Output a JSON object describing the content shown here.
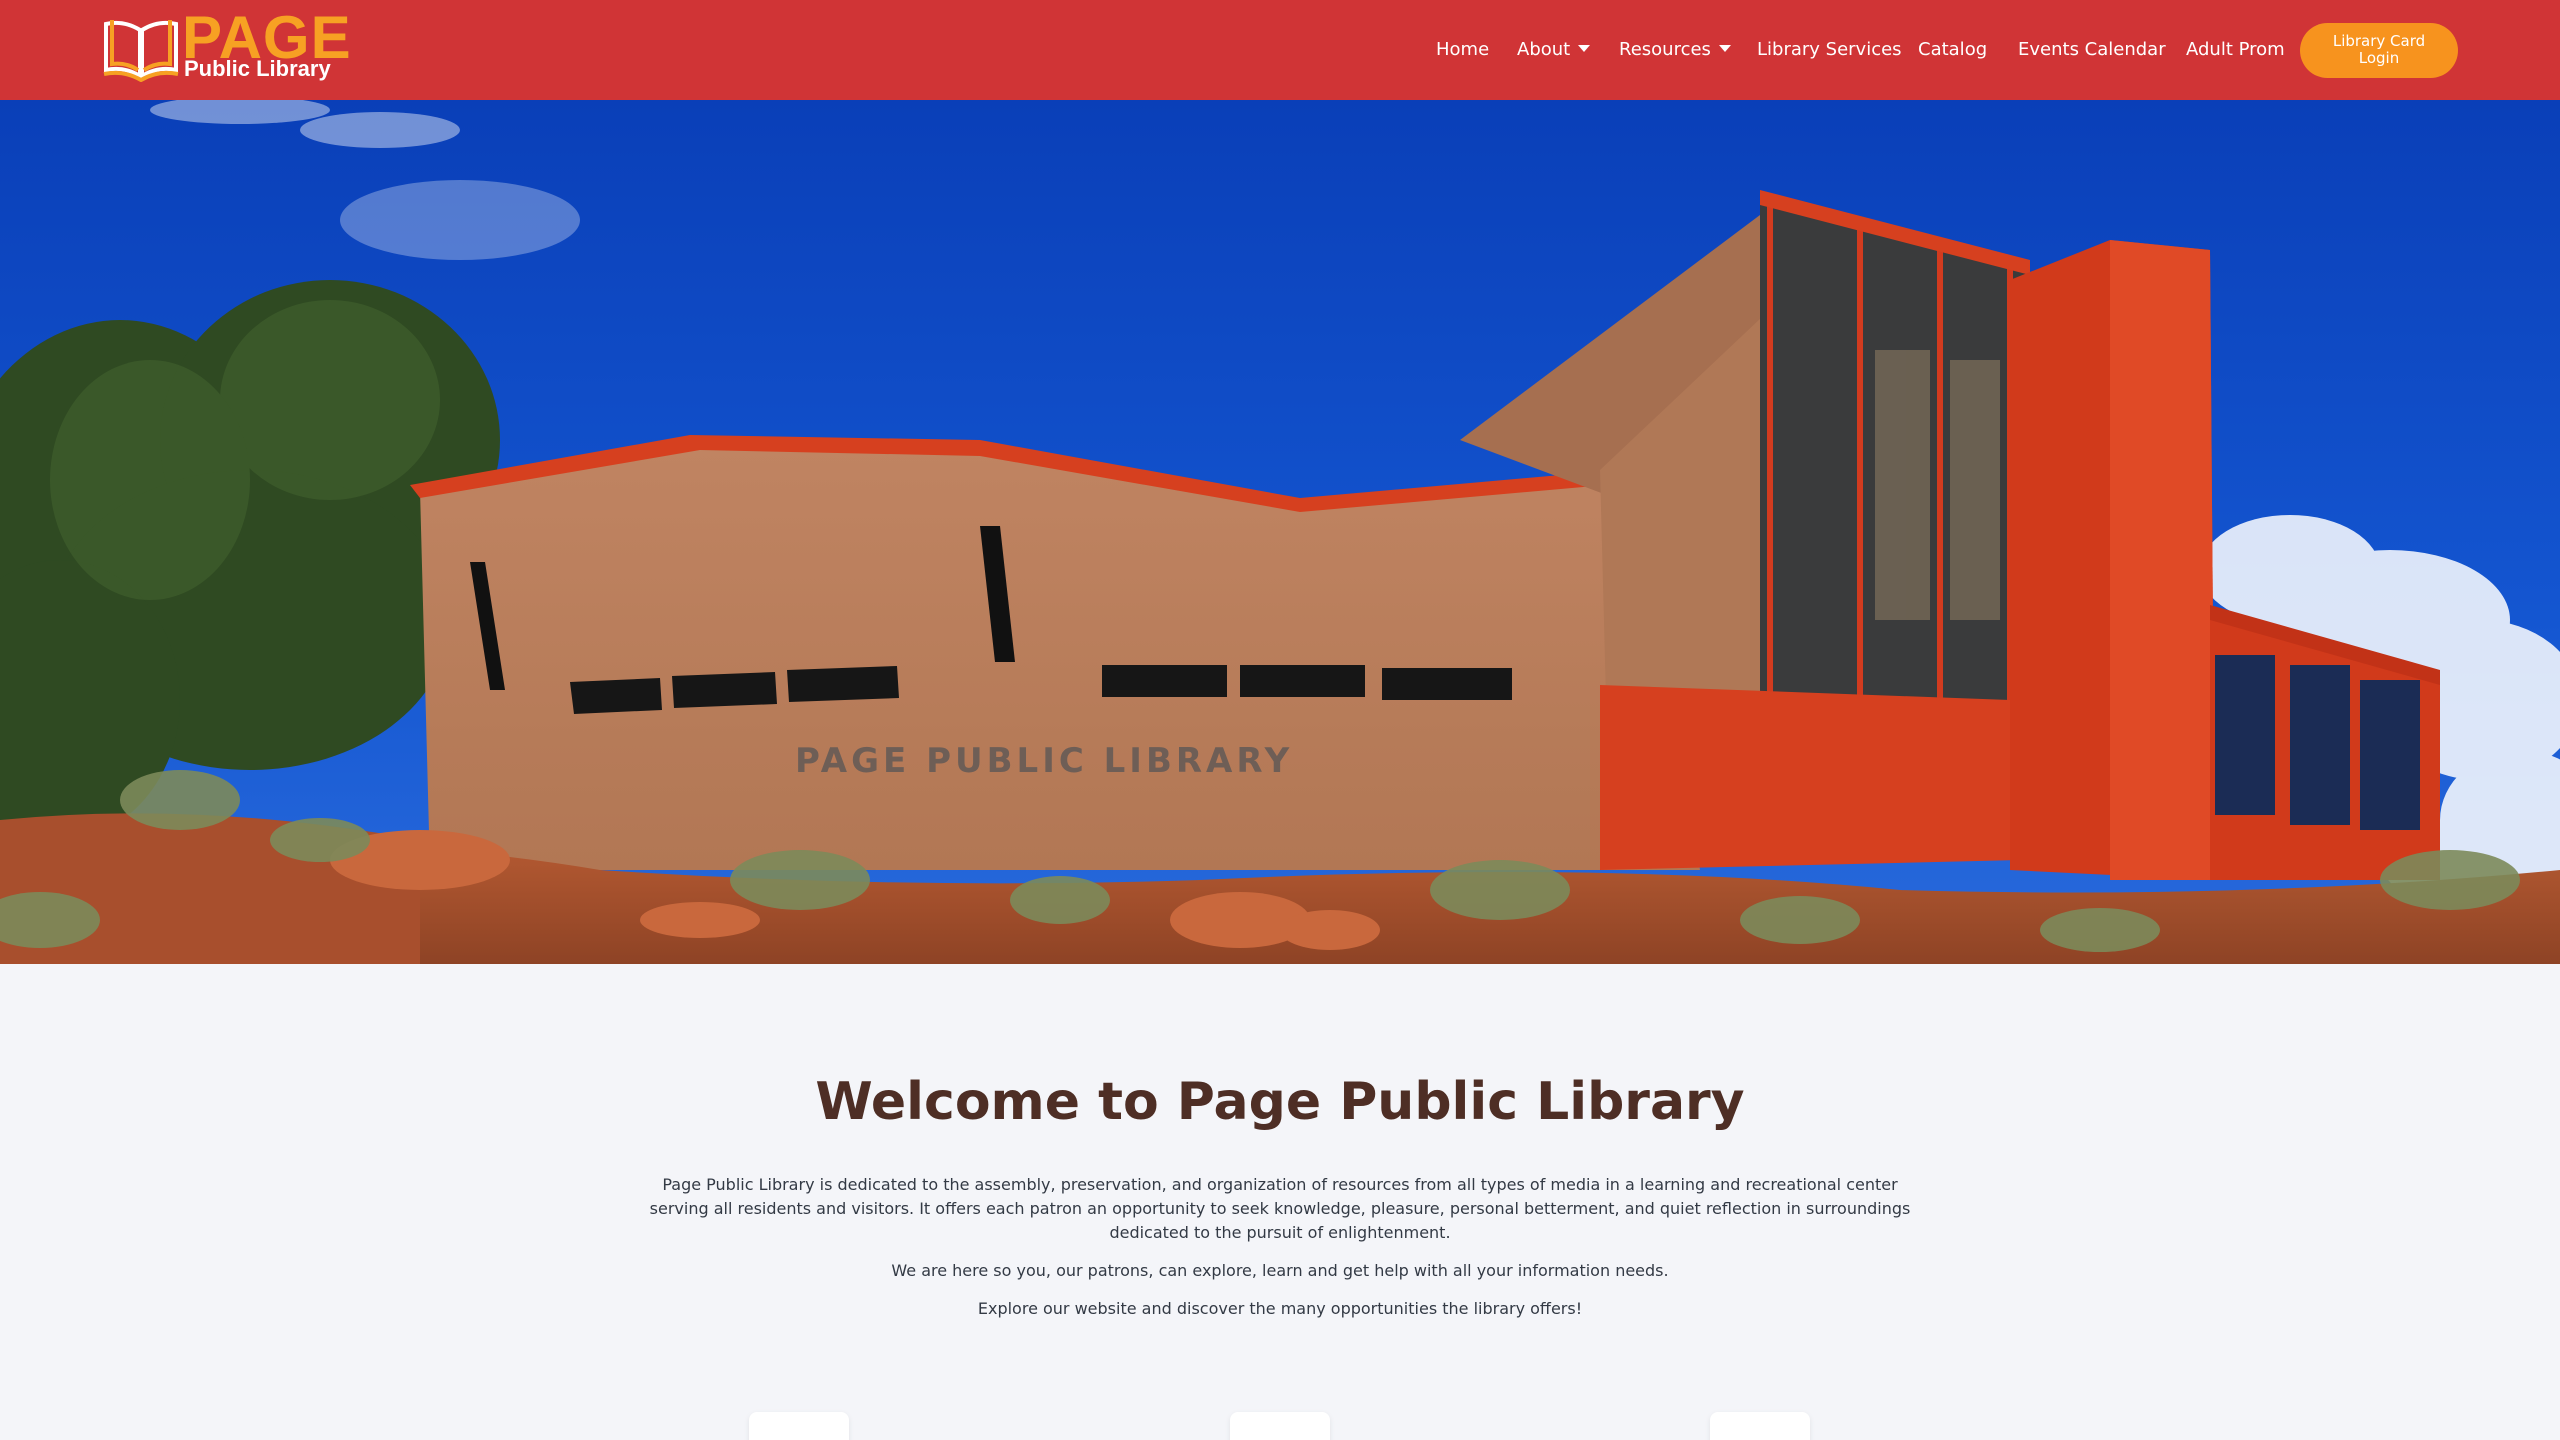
{
  "header": {
    "logo": {
      "title": "PAGE",
      "subtitle": "Public Library"
    },
    "nav": [
      {
        "label": "Home"
      },
      {
        "label": "About"
      },
      {
        "label": "Resources"
      },
      {
        "label": "Library Services"
      },
      {
        "label": "Catalog"
      },
      {
        "label": "Events Calendar"
      },
      {
        "label": "Adult Prom"
      }
    ],
    "login_button": {
      "line1": "Library Card",
      "line2": "Login"
    }
  },
  "hero": {
    "sign_text": "PAGE PUBLIC LIBRARY"
  },
  "welcome": {
    "title": "Welcome to Page Public Library",
    "paragraph1": "Page Public Library is dedicated to the assembly, preservation, and organization of resources from all types of media in a learning and recreational center serving all residents and visitors. It offers each patron an opportunity to seek knowledge, pleasure, personal betterment, and quiet reflection in surroundings dedicated to the pursuit of enlightenment.",
    "paragraph2": "We are here so you, our patrons, can explore, learn and get help with all your information needs.",
    "paragraph3": "Explore our website and discover the many opportunities the library offers!"
  },
  "colors": {
    "header_bg": "#d03436",
    "accent_orange": "#f7931e",
    "logo_orange": "#f7a123",
    "title_brown": "#4e2e25",
    "page_bg": "#f4f5f9"
  }
}
